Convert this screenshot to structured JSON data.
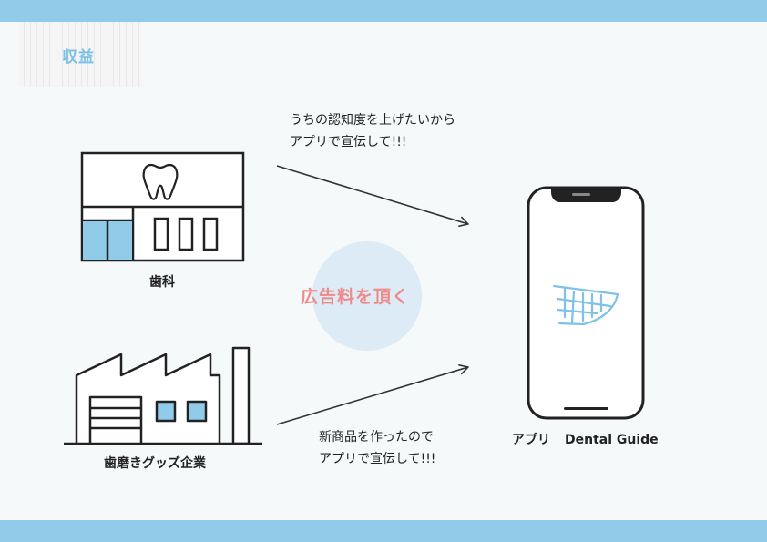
{
  "header": {
    "title": "収益"
  },
  "flows": {
    "clinic_message_line1": "うちの認知度を上げたいから",
    "clinic_message_line2": "アプリで宣伝して!!!",
    "company_message_line1": "新商品を作ったので",
    "company_message_line2": "アプリで宣伝して!!!",
    "center_label": "広告料を頂く"
  },
  "nodes": {
    "clinic_label": "歯科",
    "company_label": "歯磨きグッズ企業",
    "app_label_prefix": "アプリ",
    "app_label_name": "Dental Guide"
  },
  "colors": {
    "band": "#90cbea",
    "accent_blue": "#90cbea",
    "highlight_pink": "#ef8a8a",
    "circle": "#ddebf6"
  }
}
